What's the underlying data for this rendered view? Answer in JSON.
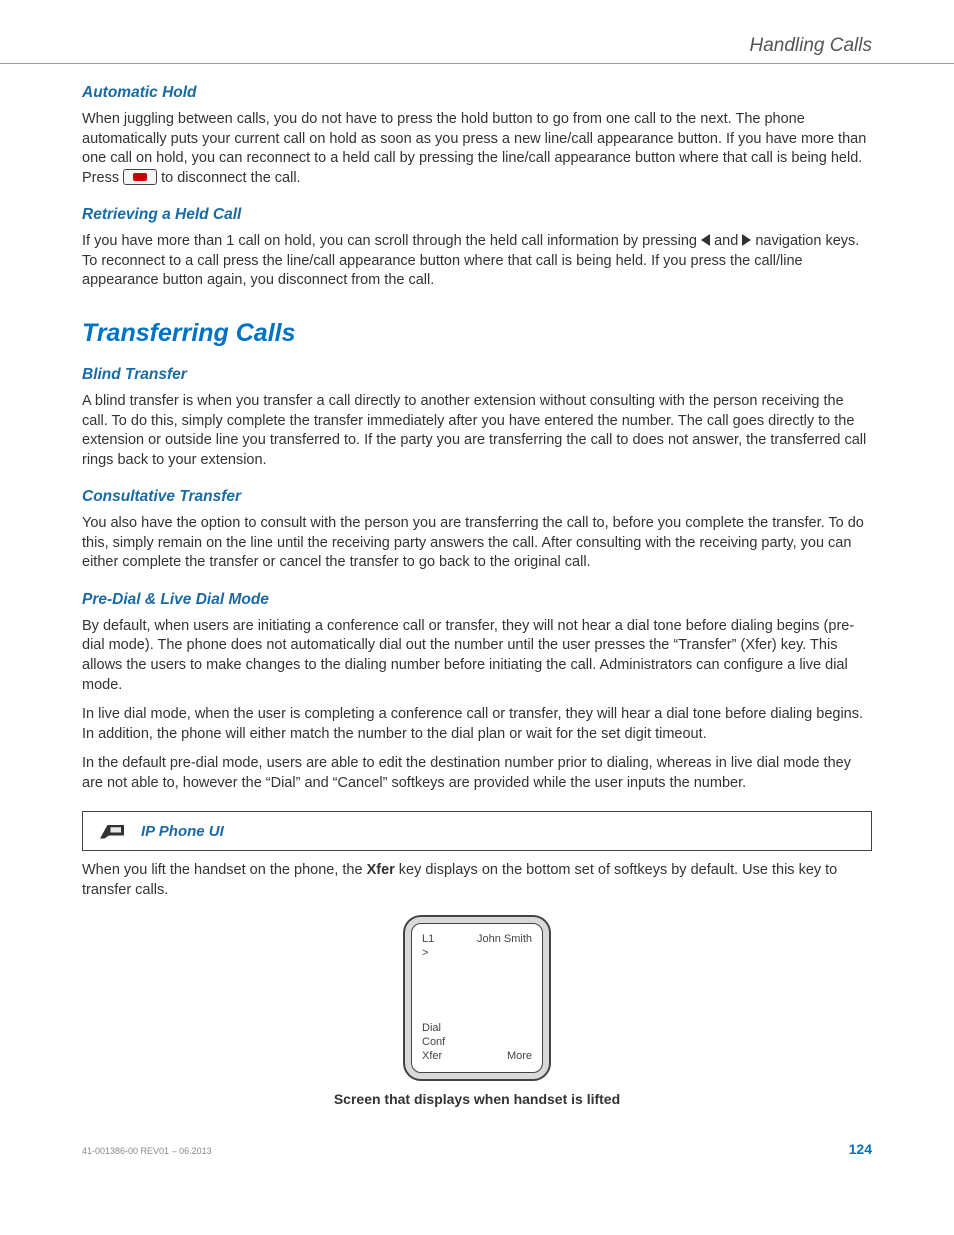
{
  "header": {
    "running_title": "Handling Calls"
  },
  "sections": {
    "auto_hold": {
      "title": "Automatic Hold",
      "p1a": "When juggling between calls, you do not have to press the hold button to go from one call to the next. The phone automatically puts your current call on hold as soon as you press a new line/call appearance button. If you have more than one call on hold, you can reconnect to a held call by pressing the line/call appearance button where that call is being held. Press ",
      "p1b": " to disconnect the call."
    },
    "retrieve": {
      "title": "Retrieving a Held Call",
      "p1a": "If you have more than 1 call on hold, you can scroll through the held call information by pressing ",
      "p1b": " and ",
      "p1c": " navigation keys. To reconnect to a call press the line/call appearance button where that call is being held. If you press the call/line appearance button again, you disconnect from the call."
    },
    "transfer": {
      "title": "Transferring Calls"
    },
    "blind": {
      "title": "Blind Transfer",
      "p1": "A blind transfer is when you transfer a call directly to another extension without consulting with the person receiving the call. To do this, simply complete the transfer immediately after you have entered the number. The call goes directly to the extension or outside line you transferred to. If the party you are transferring the call to does not answer, the transferred call rings back to your extension."
    },
    "consult": {
      "title": "Consultative Transfer",
      "p1": "You also have the option to consult with the person you are transferring the call to, before you complete the transfer. To do this, simply remain on the line until the receiving party answers the call. After consulting with the receiving party, you can either complete the transfer or cancel the transfer to go back to the original call."
    },
    "predial": {
      "title": "Pre-Dial & Live Dial Mode",
      "p1": "By default, when users are initiating a conference call or transfer, they will not hear a dial tone before dialing begins (pre-dial mode). The phone does not automatically dial out the number until the user presses the “Transfer” (Xfer) key. This allows the users to make changes to the dialing number before initiating the call.  Administrators can configure a live dial mode.",
      "p2": "In live dial mode, when the user is completing a conference call or transfer, they will hear a dial tone before dialing begins. In addition, the phone will either match the number to the dial plan or wait for the set digit timeout.",
      "p3": "In the default pre-dial mode, users are able to edit the destination number prior to dialing, whereas in live dial mode they are not able to, however the “Dial” and “Cancel” softkeys are provided while the user inputs the number."
    },
    "ui_box": {
      "label": "IP Phone UI"
    },
    "xfer_intro": {
      "a": "When you lift the handset on the phone, the ",
      "key": "Xfer",
      "b": " key displays on the bottom set of softkeys by default. Use this key to transfer calls."
    }
  },
  "phone_screen": {
    "line": "L1",
    "name": "John Smith",
    "cursor": ">",
    "softkeys": {
      "dial": "Dial",
      "conf": "Conf",
      "xfer": "Xfer",
      "more": "More"
    },
    "caption": "Screen that displays when handset is lifted"
  },
  "footer": {
    "doc_id": "41-001386-00 REV01 – 06.2013",
    "page_num": "124"
  }
}
